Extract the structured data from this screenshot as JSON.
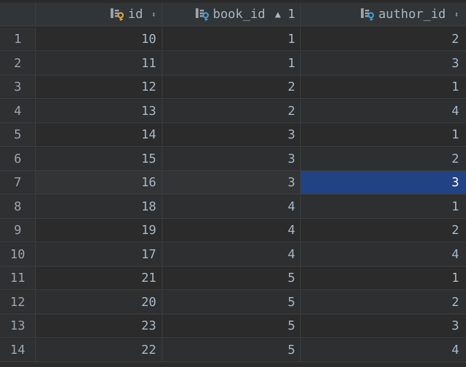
{
  "columns": {
    "id": {
      "label": "id",
      "icon": "primary-key-column-icon"
    },
    "book_id": {
      "label": "book_id",
      "icon": "foreign-key-column-icon",
      "sort_direction": "asc",
      "sort_order": "1"
    },
    "author_id": {
      "label": "author_id",
      "icon": "foreign-key-column-icon"
    }
  },
  "rows": [
    {
      "num": "1",
      "id": "10",
      "book_id": "1",
      "author_id": "2"
    },
    {
      "num": "2",
      "id": "11",
      "book_id": "1",
      "author_id": "3"
    },
    {
      "num": "3",
      "id": "12",
      "book_id": "2",
      "author_id": "1"
    },
    {
      "num": "4",
      "id": "13",
      "book_id": "2",
      "author_id": "4"
    },
    {
      "num": "5",
      "id": "14",
      "book_id": "3",
      "author_id": "1"
    },
    {
      "num": "6",
      "id": "15",
      "book_id": "3",
      "author_id": "2"
    },
    {
      "num": "7",
      "id": "16",
      "book_id": "3",
      "author_id": "3"
    },
    {
      "num": "8",
      "id": "18",
      "book_id": "4",
      "author_id": "1"
    },
    {
      "num": "9",
      "id": "19",
      "book_id": "4",
      "author_id": "2"
    },
    {
      "num": "10",
      "id": "17",
      "book_id": "4",
      "author_id": "4"
    },
    {
      "num": "11",
      "id": "21",
      "book_id": "5",
      "author_id": "1"
    },
    {
      "num": "12",
      "id": "20",
      "book_id": "5",
      "author_id": "2"
    },
    {
      "num": "13",
      "id": "23",
      "book_id": "5",
      "author_id": "3"
    },
    {
      "num": "14",
      "id": "22",
      "book_id": "5",
      "author_id": "4"
    }
  ],
  "selection": {
    "row": 7,
    "column": "author_id"
  },
  "colors": {
    "background": "#2b2b2b",
    "header": "#323537",
    "text": "#a9b7c6",
    "selection": "#214283",
    "primary_key": "#d9a343",
    "foreign_key": "#3d9bd6"
  }
}
